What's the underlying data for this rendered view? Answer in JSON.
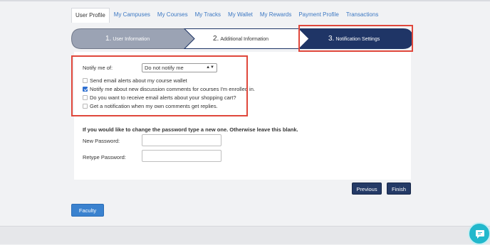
{
  "tabs": [
    {
      "label": "User Profile",
      "active": true
    },
    {
      "label": "My Campuses"
    },
    {
      "label": "My Courses"
    },
    {
      "label": "My Tracks"
    },
    {
      "label": "My Wallet"
    },
    {
      "label": "My Rewards"
    },
    {
      "label": "Payment Profile"
    },
    {
      "label": "Transactions"
    }
  ],
  "wizard": {
    "steps": [
      {
        "num": "1.",
        "label": "User Information"
      },
      {
        "num": "2.",
        "label": "Additional Information"
      },
      {
        "num": "3.",
        "label": "Notification Settings"
      }
    ],
    "current_step": 3,
    "colors": {
      "done": "#9ba3b4",
      "pending": "#ffffff",
      "current": "#1f3566"
    }
  },
  "notify": {
    "label": "Notify me of:",
    "selected": "Do not notify me",
    "options": [
      {
        "label": "Send email alerts about my course wallet",
        "checked": false
      },
      {
        "label": "Notify me about new discussion comments for courses I'm enrolled in.",
        "checked": true
      },
      {
        "label": "Do you want to receive email alerts about your shopping cart?",
        "checked": false
      },
      {
        "label": "Get a notification when my own comments get replies.",
        "checked": false
      }
    ]
  },
  "password": {
    "info": "If you would like to change the password type a new one. Otherwise leave this blank.",
    "new_label": "New Password:",
    "new_value": "",
    "retype_label": "Retype Password:",
    "retype_value": ""
  },
  "buttons": {
    "previous": "Previous",
    "finish": "Finish",
    "faculty": "Faculty"
  },
  "colors": {
    "accent": "#3c78c3",
    "highlight": "#e0473b",
    "primary_button": "#243a66",
    "chat": "#22b8cc"
  },
  "chat_icon": "chat-bubble-icon"
}
